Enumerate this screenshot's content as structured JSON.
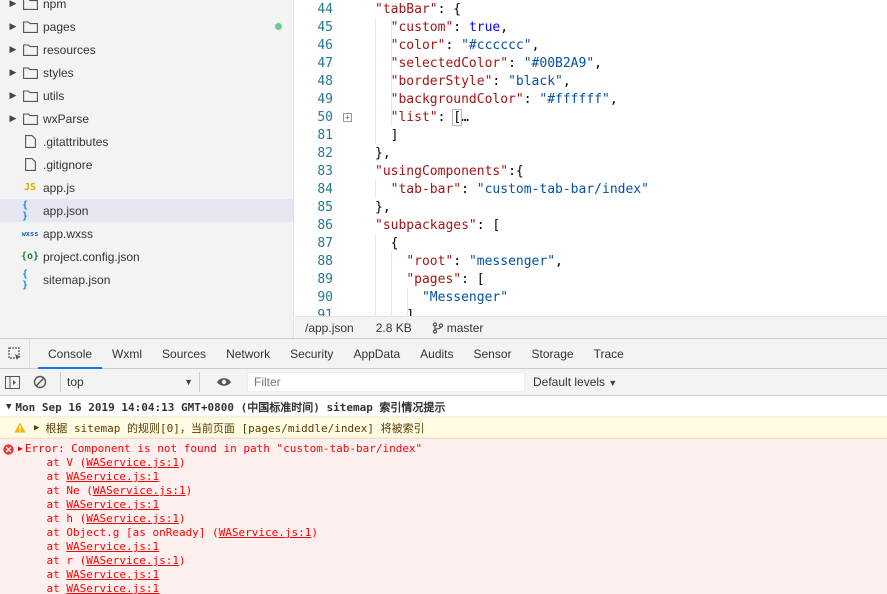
{
  "explorer": {
    "items": [
      {
        "label": "npm",
        "type": "folder",
        "expandable": true,
        "dot": false
      },
      {
        "label": "pages",
        "type": "folder",
        "expandable": true,
        "dot": true
      },
      {
        "label": "resources",
        "type": "folder",
        "expandable": true,
        "dot": false
      },
      {
        "label": "styles",
        "type": "folder",
        "expandable": true,
        "dot": false
      },
      {
        "label": "utils",
        "type": "folder",
        "expandable": true,
        "dot": false
      },
      {
        "label": "wxParse",
        "type": "folder",
        "expandable": true,
        "dot": false
      },
      {
        "label": ".gitattributes",
        "type": "file",
        "icon_text": "",
        "expandable": false,
        "dot": false
      },
      {
        "label": ".gitignore",
        "type": "file",
        "icon_text": "",
        "expandable": false,
        "dot": false
      },
      {
        "label": "app.js",
        "type": "js",
        "icon_text": "JS",
        "expandable": false,
        "dot": false
      },
      {
        "label": "app.json",
        "type": "json",
        "icon_text": "{ }",
        "expandable": false,
        "dot": false,
        "selected": true
      },
      {
        "label": "app.wxss",
        "type": "wxss",
        "icon_text": "wxss",
        "expandable": false,
        "dot": false
      },
      {
        "label": "project.config.json",
        "type": "config",
        "icon_text": "{o}",
        "expandable": false,
        "dot": false
      },
      {
        "label": "sitemap.json",
        "type": "json",
        "icon_text": "{ }",
        "expandable": false,
        "dot": false
      }
    ],
    "colors": {
      "dot": "#73c991",
      "js": "#e0a800",
      "json": "#1e88e5",
      "wxss": "#1565c0",
      "config": "#2e7d32"
    }
  },
  "editor": {
    "lines": [
      {
        "num": "44",
        "text": "  \"tabBar\": {"
      },
      {
        "num": "45",
        "text": "    \"custom\": true,"
      },
      {
        "num": "46",
        "text": "    \"color\": \"#cccccc\","
      },
      {
        "num": "47",
        "text": "    \"selectedColor\": \"#00B2A9\","
      },
      {
        "num": "48",
        "text": "    \"borderStyle\": \"black\","
      },
      {
        "num": "49",
        "text": "    \"backgroundColor\": \"#ffffff\","
      },
      {
        "num": "50",
        "text": "    \"list\": […",
        "fold": "+"
      },
      {
        "num": "81",
        "text": "    ]"
      },
      {
        "num": "82",
        "text": "  },"
      },
      {
        "num": "83",
        "text": "  \"usingComponents\":{"
      },
      {
        "num": "84",
        "text": "    \"tab-bar\": \"custom-tab-bar/index\""
      },
      {
        "num": "85",
        "text": "  },"
      },
      {
        "num": "86",
        "text": "  \"subpackages\": ["
      },
      {
        "num": "87",
        "text": "    {"
      },
      {
        "num": "88",
        "text": "      \"root\": \"messenger\","
      },
      {
        "num": "89",
        "text": "      \"pages\": ["
      },
      {
        "num": "90",
        "text": "        \"Messenger\""
      },
      {
        "num": "91",
        "text": "      ]"
      }
    ]
  },
  "statusbar": {
    "path": "/app.json",
    "size": "2.8 KB",
    "branch": "master"
  },
  "devtools": {
    "tabs": [
      "Console",
      "Wxml",
      "Sources",
      "Network",
      "Security",
      "AppData",
      "Audits",
      "Sensor",
      "Storage",
      "Trace"
    ],
    "active_tab": "Console",
    "context": "top",
    "filter_placeholder": "Filter",
    "levels": "Default levels",
    "console": {
      "group_header": "Mon Sep 16 2019 14:04:13 GMT+0800 (中国标准时间) sitemap 索引情况提示",
      "warning": "根据 sitemap 的规则[0]，当前页面 [pages/middle/index] 将被索引",
      "error_message": "Error: Component is not found in path \"custom-tab-bar/index\"",
      "stack": [
        {
          "prefix": "    at V (",
          "link": "WAService.js:1",
          "suffix": ")"
        },
        {
          "prefix": "    at ",
          "link": "WAService.js:1",
          "suffix": ""
        },
        {
          "prefix": "    at Ne (",
          "link": "WAService.js:1",
          "suffix": ")"
        },
        {
          "prefix": "    at ",
          "link": "WAService.js:1",
          "suffix": ""
        },
        {
          "prefix": "    at h (",
          "link": "WAService.js:1",
          "suffix": ")"
        },
        {
          "prefix": "    at Object.g [as onReady] (",
          "link": "WAService.js:1",
          "suffix": ")"
        },
        {
          "prefix": "    at ",
          "link": "WAService.js:1",
          "suffix": ""
        },
        {
          "prefix": "    at r (",
          "link": "WAService.js:1",
          "suffix": ")"
        },
        {
          "prefix": "    at ",
          "link": "WAService.js:1",
          "suffix": ""
        },
        {
          "prefix": "    at ",
          "link": "WAService.js:1",
          "suffix": ""
        }
      ]
    }
  }
}
